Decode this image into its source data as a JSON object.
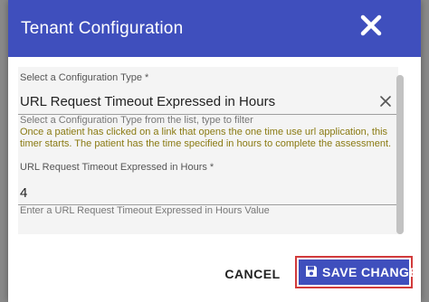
{
  "background": {
    "row_chars": [
      "C",
      "C",
      "",
      "",
      "",
      "",
      "",
      ""
    ]
  },
  "dialog": {
    "title": "Tenant Configuration",
    "close_icon": "close-icon"
  },
  "config_type": {
    "label": "Select a Configuration Type",
    "required_mark": "*",
    "value": "URL Request Timeout Expressed in Hours",
    "helper": "Select a Configuration Type from the list, type to filter",
    "description": "Once a patient has clicked on a link that opens the one time use url application, this timer starts. The patient has the time specified in hours to complete the assessment.",
    "clear_icon": "clear-x-icon"
  },
  "value_field": {
    "label": "URL Request Timeout Expressed in Hours",
    "required_mark": "*",
    "value": "4",
    "helper": "Enter a URL Request Timeout Expressed in Hours Value"
  },
  "actions": {
    "cancel_label": "CANCEL",
    "save_label": "SAVE CHANGES",
    "save_icon": "floppy-disk-icon"
  },
  "colors": {
    "header": "#3f4fbd",
    "primary_button": "#3f4fbd",
    "highlight_border": "#d23b3b",
    "description_text": "#8a7a12"
  }
}
